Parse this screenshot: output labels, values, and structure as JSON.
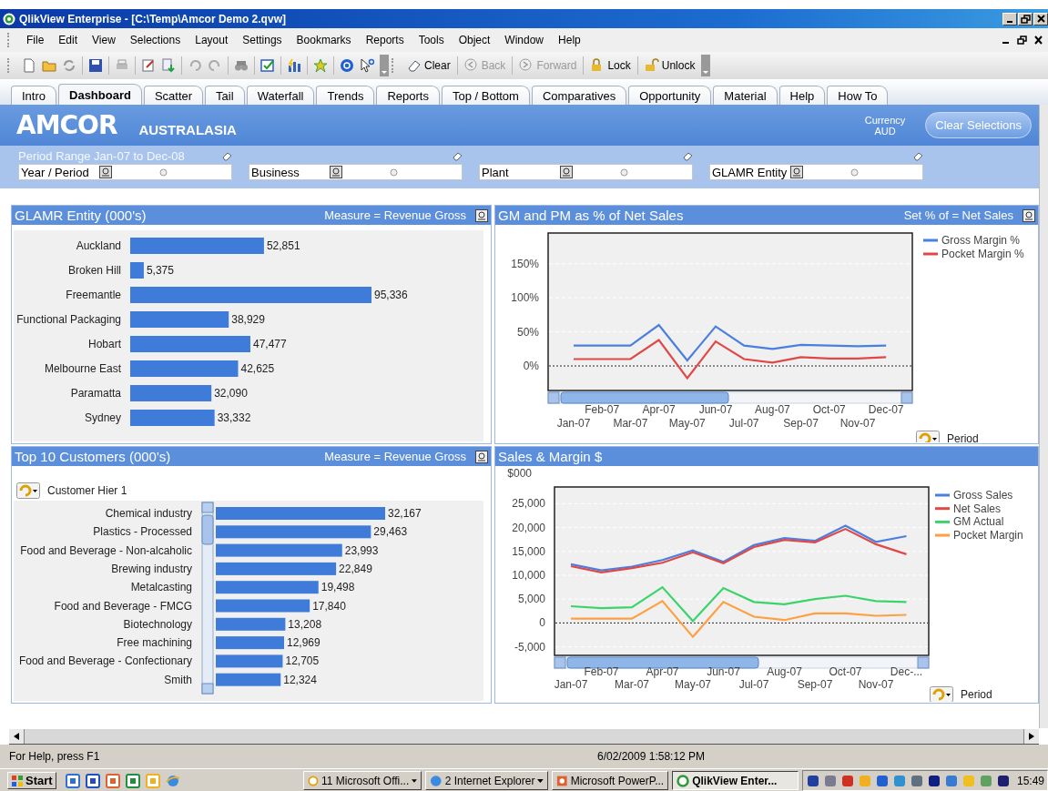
{
  "window": {
    "title": "QlikView Enterprise - [C:\\Temp\\Amcor Demo 2.qvw]"
  },
  "menu": [
    "File",
    "Edit",
    "View",
    "Selections",
    "Layout",
    "Settings",
    "Bookmarks",
    "Reports",
    "Tools",
    "Object",
    "Window",
    "Help"
  ],
  "toolbar": {
    "buttons": [
      {
        "label": "Clear",
        "disabled": false
      },
      {
        "label": "Back",
        "disabled": true
      },
      {
        "label": "Forward",
        "disabled": true
      },
      {
        "label": "Lock",
        "disabled": false
      },
      {
        "label": "Unlock",
        "disabled": false
      }
    ]
  },
  "tabs": [
    {
      "label": "Intro",
      "selected": false
    },
    {
      "label": "Dashboard",
      "selected": true
    },
    {
      "label": "Scatter",
      "selected": false
    },
    {
      "label": "Tail",
      "selected": false
    },
    {
      "label": "Waterfall",
      "selected": false
    },
    {
      "label": "Trends",
      "selected": false
    },
    {
      "label": "Reports",
      "selected": false
    },
    {
      "label": "Top / Bottom",
      "selected": false
    },
    {
      "label": "Comparatives",
      "selected": false
    },
    {
      "label": "Opportunity",
      "selected": false
    },
    {
      "label": "Material",
      "selected": false
    },
    {
      "label": "Help",
      "selected": false
    },
    {
      "label": "How To",
      "selected": false
    }
  ],
  "header": {
    "logo": "AMCOR",
    "region": "AUSTRALASIA",
    "currency_label": "Currency",
    "currency": "AUD",
    "button": "Clear Selections"
  },
  "filters": {
    "title": "Period Range Jan-07 to Dec-08",
    "fields": [
      "Year / Period",
      "Business",
      "Plant",
      "GLAMR Entity"
    ]
  },
  "panels": [
    {
      "title": "GLAMR Entity (000's)",
      "measure": "Measure = Revenue Gross",
      "chart_data": {
        "type": "bar",
        "orientation": "horizontal",
        "categories": [
          "Auckland",
          "Broken Hill",
          "Freemantle",
          "Functional Packaging",
          "Hobart",
          "Melbourne East",
          "Paramatta",
          "Sydney"
        ],
        "values": [
          52851,
          5375,
          95336,
          38929,
          47477,
          42625,
          32090,
          33332
        ],
        "value_labels": [
          "52,851",
          "5,375",
          "95,336",
          "38,929",
          "47,477",
          "42,625",
          "32,090",
          "33,332"
        ]
      }
    },
    {
      "title": "GM and PM as % of Net Sales",
      "measure": "Set % of = Net Sales",
      "cycle_label": "Period",
      "chart_data": {
        "type": "line",
        "categories": [
          "Jan-07",
          "Feb-07",
          "Mar-07",
          "Apr-07",
          "May-07",
          "Jun-07",
          "Jul-07",
          "Aug-07",
          "Sep-07",
          "Oct-07",
          "Nov-07",
          "Dec-07"
        ],
        "ylim": [
          -36,
          195
        ],
        "grid": true,
        "legend": true,
        "ref_lines": [
          {
            "axis": "y",
            "value": 0
          }
        ],
        "yticks": [
          {
            "value": 0,
            "label": "0%"
          },
          {
            "value": 50,
            "label": "50%"
          },
          {
            "value": 100,
            "label": "100%"
          },
          {
            "value": 150,
            "label": "150%"
          }
        ],
        "series": [
          {
            "name": "Gross Margin %",
            "color": "#4a7fe0",
            "values": [
              30,
              30,
              30,
              60,
              8,
              58,
              30,
              25,
              31,
              30,
              29,
              30
            ]
          },
          {
            "name": "Pocket Margin %",
            "color": "#e04848",
            "values": [
              10,
              10,
              10,
              38,
              -18,
              36,
              10,
              5,
              13,
              11,
              11,
              13
            ]
          }
        ]
      }
    },
    {
      "title": "Top 10 Customers (000's)",
      "measure": "Measure = Revenue Gross",
      "cycle_label": "Customer Hier 1",
      "chart_data": {
        "type": "bar",
        "orientation": "horizontal",
        "categories": [
          "Chemical industry",
          "Plastics - Processed",
          "Food and Beverage - Non-alcaholic",
          "Brewing industry",
          "Metalcasting",
          "Food and Beverage - FMCG",
          "Biotechnology",
          "Free machining",
          "Food and Beverage - Confectionary",
          "Smith"
        ],
        "values": [
          32167,
          29463,
          23993,
          22849,
          19498,
          17840,
          13208,
          12969,
          12705,
          12324
        ],
        "value_labels": [
          "32,167",
          "29,463",
          "23,993",
          "22,849",
          "19,498",
          "17,840",
          "13,208",
          "12,969",
          "12,705",
          "12,324"
        ]
      }
    },
    {
      "title": "Sales & Margin $",
      "cycle_label": "Period",
      "chart_data": {
        "type": "line",
        "ylabel": "$000",
        "categories": [
          "Jan-07",
          "Feb-07",
          "Mar-07",
          "Apr-07",
          "May-07",
          "Jun-07",
          "Jul-07",
          "Aug-07",
          "Sep-07",
          "Oct-07",
          "Nov-07",
          "Dec-..."
        ],
        "ylim": [
          -6800,
          28500
        ],
        "grid": true,
        "legend": true,
        "ref_lines": [
          {
            "axis": "y",
            "value": 0
          }
        ],
        "yticks": [
          {
            "value": -5000,
            "label": "-5,000"
          },
          {
            "value": 0,
            "label": "0"
          },
          {
            "value": 5000,
            "label": "5,000"
          },
          {
            "value": 10000,
            "label": "10,000"
          },
          {
            "value": 15000,
            "label": "15,000"
          },
          {
            "value": 20000,
            "label": "20,000"
          },
          {
            "value": 25000,
            "label": "25,000"
          }
        ],
        "series": [
          {
            "name": "Gross Sales",
            "color": "#4a7fe0",
            "values": [
              12300,
              11000,
              11800,
              13200,
              15200,
              12800,
              16300,
              17800,
              17200,
              20400,
              17000,
              18200
            ]
          },
          {
            "name": "Net Sales",
            "color": "#e04848",
            "values": [
              11900,
              10600,
              11500,
              12600,
              14800,
              12500,
              15900,
              17400,
              16900,
              19700,
              16500,
              14400
            ]
          },
          {
            "name": "GM Actual",
            "color": "#3cd46a",
            "values": [
              3500,
              3100,
              3300,
              7500,
              400,
              7300,
              4400,
              3900,
              5000,
              5700,
              4600,
              4400
            ]
          },
          {
            "name": "Pocket Margin",
            "color": "#ffa040",
            "values": [
              900,
              900,
              900,
              4600,
              -2900,
              4400,
              1300,
              600,
              2000,
              2000,
              1500,
              1700
            ]
          }
        ]
      }
    }
  ],
  "status_bar": {
    "help": "For Help, press F1",
    "timestamp": "6/02/2009 1:58:12 PM"
  },
  "taskbar": {
    "start": "Start",
    "tasks": [
      {
        "count": "11",
        "label": "Microsoft Offi...",
        "selected": false
      },
      {
        "count": "2",
        "label": "Internet Explorer",
        "selected": false
      },
      {
        "label": "Microsoft PowerP...",
        "selected": false
      },
      {
        "label": "QlikView Enter...",
        "selected": true
      }
    ],
    "clock": "15:49"
  }
}
